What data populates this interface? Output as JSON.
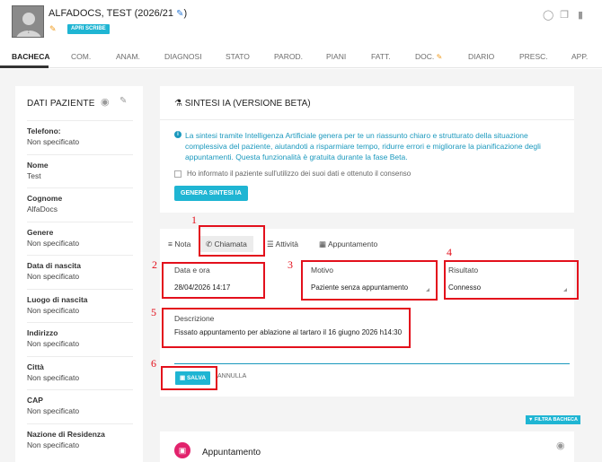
{
  "header": {
    "patient_name": "ALFADOCS, TEST (2026/21",
    "name_suffix": ")",
    "scribe_button": "APRI SCRIBE",
    "icons": [
      "whatsapp-icon",
      "copy-icon",
      "trash-icon"
    ]
  },
  "tabs": [
    "BACHECA",
    "COM.",
    "ANAM.",
    "DIAGNOSI",
    "STATO",
    "PAROD.",
    "PIANI",
    "FATT.",
    "DOC.",
    "DIARIO",
    "PRESC.",
    "APP."
  ],
  "sidebar": {
    "title": "DATI PAZIENTE",
    "fields": [
      {
        "label": "Telefono:",
        "value": "Non specificato"
      },
      {
        "label": "Nome",
        "value": "Test"
      },
      {
        "label": "Cognome",
        "value": "AlfaDocs"
      },
      {
        "label": "Genere",
        "value": "Non specificato"
      },
      {
        "label": "Data di nascita",
        "value": "Non specificato"
      },
      {
        "label": "Luogo di nascita",
        "value": "Non specificato"
      },
      {
        "label": "Indirizzo",
        "value": "Non specificato"
      },
      {
        "label": "Città",
        "value": "Non specificato"
      },
      {
        "label": "CAP",
        "value": "Non specificato"
      },
      {
        "label": "Nazione di Residenza",
        "value": "Non specificato"
      }
    ]
  },
  "ai": {
    "title": "SINTESI IA (VERSIONE BETA)",
    "info": "La sintesi tramite Intelligenza Artificiale genera per te un riassunto chiaro e strutturato della situazione complessiva del paziente, aiutandoti a risparmiare tempo, ridurre errori e migliorare la pianificazione degli appuntamenti. Questa funzionalità è gratuita durante la fase Beta.",
    "consent": "Ho informato il paziente sull'utilizzo dei suoi dati e ottenuto il consenso",
    "generate_button": "GENERA SINTESI IA"
  },
  "form": {
    "tabs": [
      "Nota",
      "Chiamata",
      "Attività",
      "Appuntamento"
    ],
    "active_tab": "Chiamata",
    "date_label": "Data e ora",
    "date_value": "28/04/2026 14:17",
    "reason_label": "Motivo",
    "reason_value": "Paziente senza appuntamento",
    "result_label": "Risultato",
    "result_value": "Connesso",
    "description_label": "Descrizione",
    "description_value": "Fissato appuntamento per ablazione al tartaro il 16 giugno 2026 h14:30",
    "save_button": "SALVA",
    "cancel_button": "ANNULLA"
  },
  "filter_button": "FILTRA BACHECA",
  "appointment": {
    "title": "Appuntamento"
  },
  "annotations": [
    "1",
    "2",
    "3",
    "4",
    "5",
    "6"
  ],
  "colors": {
    "accent": "#1fb5d3",
    "info_text": "#1a98bd",
    "annotation_red": "#e3101c",
    "appointment_pink": "#e2226c"
  }
}
